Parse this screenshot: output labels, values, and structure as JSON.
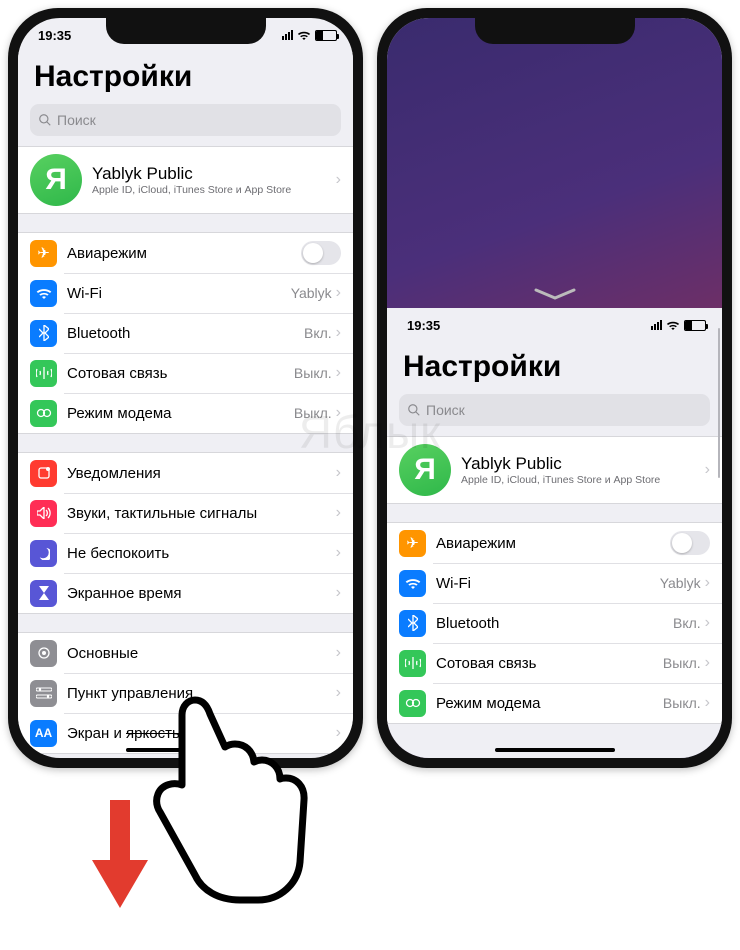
{
  "status": {
    "time": "19:35"
  },
  "settings_title": "Настройки",
  "search_placeholder": "Поиск",
  "apple_id": {
    "avatar_letter": "Я",
    "name": "Yablyk Public",
    "subtitle": "Apple ID, iCloud, iTunes Store и App Store"
  },
  "group1": {
    "airplane": "Авиарежим",
    "wifi_label": "Wi-Fi",
    "wifi_value": "Yablyk",
    "bluetooth_label": "Bluetooth",
    "bluetooth_value": "Вкл.",
    "cellular_label": "Сотовая связь",
    "cellular_value": "Выкл.",
    "hotspot_label": "Режим модема",
    "hotspot_value": "Выкл."
  },
  "group2": {
    "notifications": "Уведомления",
    "sounds": "Звуки, тактильные сигналы",
    "dnd": "Не беспокоить",
    "screentime": "Экранное время"
  },
  "group3": {
    "general": "Основные",
    "control_center": "Пункт управления",
    "display_prefix": "Экран и ",
    "display_strike": "яркость"
  },
  "icons": {
    "airplane": {
      "glyph": "✈",
      "bg": "#ff9500"
    },
    "wifi": {
      "glyph": "wifi",
      "bg": "#0a7cff"
    },
    "bluetooth": {
      "glyph": "bt",
      "bg": "#0a7cff"
    },
    "cellular": {
      "glyph": "ant",
      "bg": "#34c759"
    },
    "hotspot": {
      "glyph": "link",
      "bg": "#34c759"
    },
    "notif": {
      "glyph": "bell",
      "bg": "#ff3b30"
    },
    "sounds": {
      "glyph": "vol",
      "bg": "#ff2d55"
    },
    "dnd": {
      "glyph": "moon",
      "bg": "#5856d6"
    },
    "screentime": {
      "glyph": "hour",
      "bg": "#5856d6"
    },
    "general": {
      "glyph": "gear",
      "bg": "#8e8e93"
    },
    "cc": {
      "glyph": "switch",
      "bg": "#8e8e93"
    },
    "display": {
      "glyph": "AA",
      "bg": "#0a7cff"
    }
  },
  "watermark": "Яблык"
}
